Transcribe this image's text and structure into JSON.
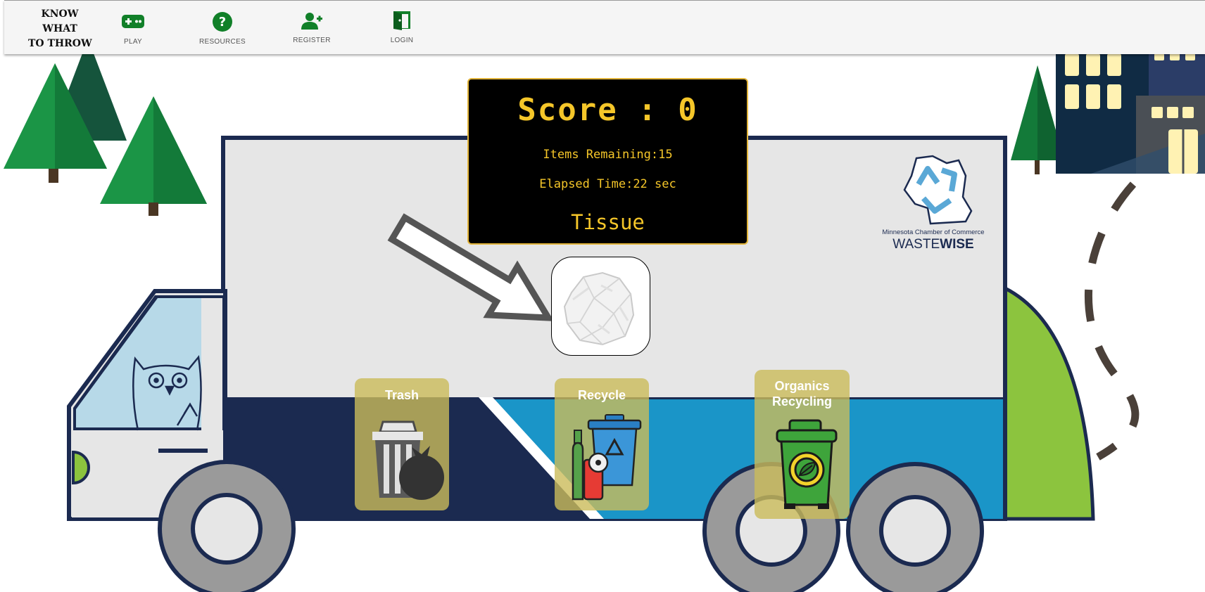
{
  "logo": {
    "line1": "KNOW",
    "line2": "WHAT",
    "line3": "TO THROW"
  },
  "nav": [
    {
      "label": "PLAY",
      "icon": "gamepad-icon"
    },
    {
      "label": "RESOURCES",
      "icon": "help-circle-icon"
    },
    {
      "label": "REGISTER",
      "icon": "add-user-icon"
    },
    {
      "label": "LOGIN",
      "icon": "door-icon"
    }
  ],
  "game": {
    "score_label": "Score : ",
    "score": "0",
    "items_remaining_label": "Items Remaining:",
    "items_remaining": "15",
    "elapsed_label": "Elapsed Time:",
    "elapsed": "22 sec",
    "current_item": "Tissue"
  },
  "bins": [
    {
      "line1": "Trash",
      "line2": ""
    },
    {
      "line1": "Recycle",
      "line2": ""
    },
    {
      "line1": "Organics",
      "line2": "Recycling"
    }
  ],
  "sponsor": {
    "line1": "Minnesota Chamber of Commerce",
    "brand_a": "WASTE",
    "brand_b": "WISE"
  },
  "colors": {
    "accent_green": "#118029",
    "scoreboard_text": "#f5c629",
    "truck_navy": "#1b2a50",
    "truck_teal": "#1a95c8",
    "bin_bg": "#cbbb5a"
  }
}
